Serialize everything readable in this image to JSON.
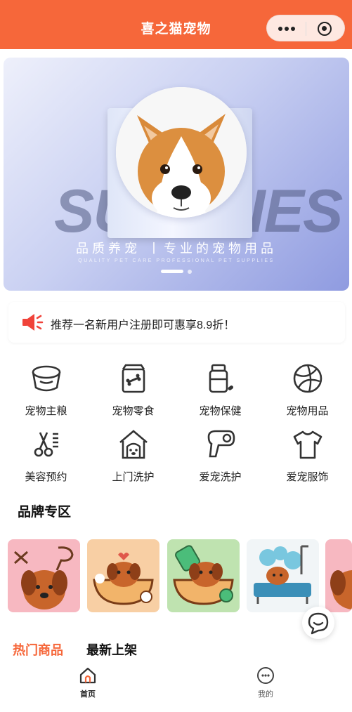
{
  "header": {
    "title": "喜之猫宠物"
  },
  "banner": {
    "bg_word": "SUPPLIES",
    "slogan": "品质养宠 丨专业的宠物用品",
    "subtitle": "QUALITY PET CARE PROFESSIONAL PET SUPPLIES"
  },
  "notice": {
    "text": "推荐一名新用户注册即可惠享8.9折！"
  },
  "categories": [
    {
      "label": "宠物主粮",
      "icon": "pet-bowl-icon"
    },
    {
      "label": "宠物零食",
      "icon": "treat-bag-icon"
    },
    {
      "label": "宠物保健",
      "icon": "medicine-icon"
    },
    {
      "label": "宠物用品",
      "icon": "ball-icon"
    },
    {
      "label": "美容预约",
      "icon": "scissors-icon"
    },
    {
      "label": "上门洗护",
      "icon": "house-dog-icon"
    },
    {
      "label": "爱宠洗护",
      "icon": "hair-dryer-icon"
    },
    {
      "label": "爱宠服饰",
      "icon": "shirt-icon"
    }
  ],
  "brand": {
    "title": "品牌专区"
  },
  "tabs": {
    "hot": "热门商品",
    "new": "最新上架"
  },
  "tabbar": {
    "home": "首页",
    "mine": "我的"
  },
  "colors": {
    "primary": "#f6673a"
  }
}
